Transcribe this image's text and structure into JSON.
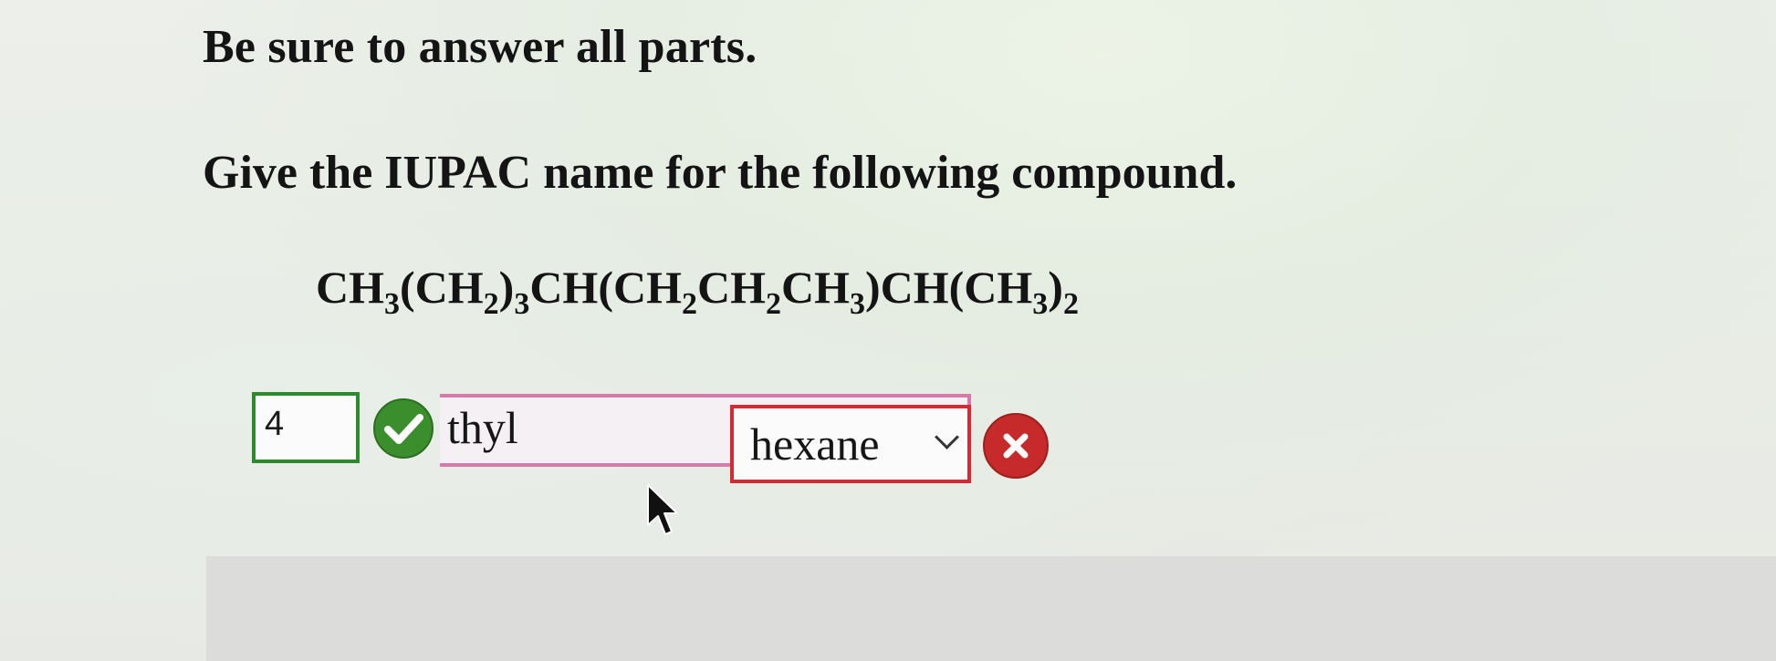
{
  "instructions": "Be sure to answer all parts.",
  "question": "Give the IUPAC name for the following compound.",
  "formula": {
    "parts": [
      "CH",
      "3",
      "(CH",
      "2",
      ")",
      "3",
      "CH(CH",
      "2",
      "CH",
      "2",
      "CH",
      "3",
      ")CH(CH",
      "3",
      ")",
      "2"
    ]
  },
  "answer": {
    "locant_value": "4",
    "prefix_selected": "thyl",
    "parent_selected": "hexane",
    "locant_status": "correct",
    "parent_status": "incorrect"
  },
  "colors": {
    "correct": "#3b8e2c",
    "incorrect": "#c62a2a",
    "prefix_border": "#d77aa8"
  },
  "icons": {
    "correct": "check-icon",
    "incorrect": "x-icon",
    "dropdown": "chevron-down-icon",
    "pointer": "cursor-icon"
  }
}
